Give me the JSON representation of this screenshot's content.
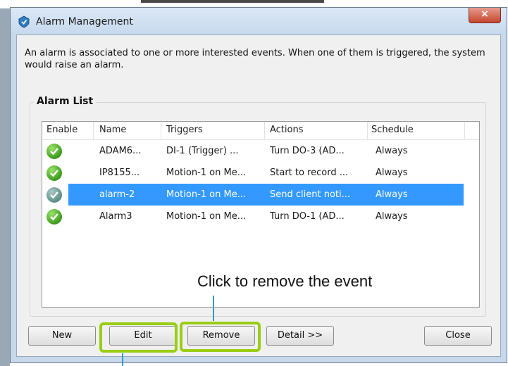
{
  "window": {
    "title": "Alarm Management",
    "close_glyph": "×"
  },
  "description": "An alarm is associated to one or more interested events. When one of them is triggered, the system would raise an alarm.",
  "alarm_list": {
    "label": "Alarm List",
    "columns": [
      "Enable",
      "Name",
      "Triggers",
      "Actions",
      "Schedule"
    ],
    "rows": [
      {
        "name": "ADAM6...",
        "triggers": "DI-1 (Trigger) ...",
        "actions": "Turn DO-3 (AD...",
        "schedule": "Always",
        "enabled": true,
        "selected": false
      },
      {
        "name": "IP8155...",
        "triggers": "Motion-1 on Me...",
        "actions": "Start to record ...",
        "schedule": "Always",
        "enabled": true,
        "selected": false
      },
      {
        "name": "alarm-2",
        "triggers": "Motion-1 on Me...",
        "actions": "Send client noti...",
        "schedule": "Always",
        "enabled": true,
        "selected": true
      },
      {
        "name": "Alarm3",
        "triggers": "Motion-1 on Me...",
        "actions": "Turn DO-1 (AD...",
        "schedule": "Always",
        "enabled": true,
        "selected": false
      }
    ]
  },
  "buttons": {
    "new": "New",
    "edit": "Edit",
    "remove": "Remove",
    "detail": "Detail >>",
    "close": "Close"
  },
  "annotation": {
    "text": "Click to remove the event",
    "highlight_color": "#9acd14",
    "line_color": "#2a9ed0"
  },
  "colors": {
    "selection": "#3399ff",
    "enabled_check": "#3c9a1e"
  }
}
